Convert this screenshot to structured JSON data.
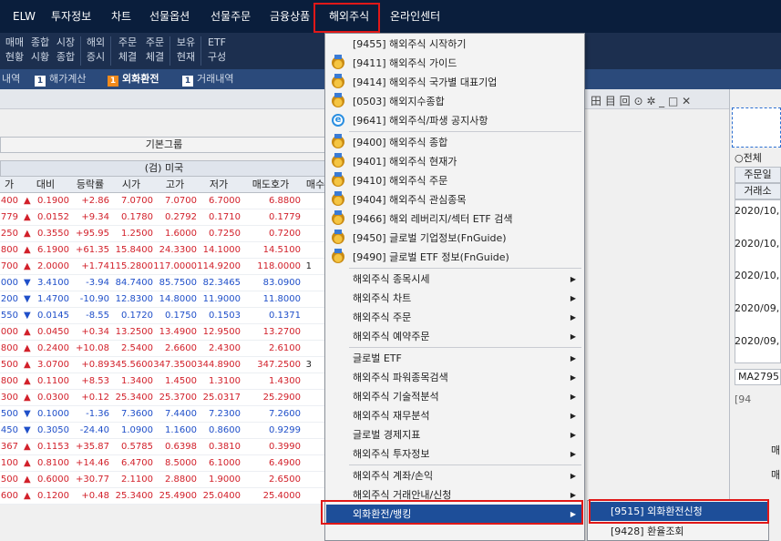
{
  "menubar": {
    "items": [
      "ELW",
      "투자정보",
      "차트",
      "선물옵션",
      "선물주문",
      "금융상품",
      "해외주식",
      "온라인센터"
    ],
    "active_item": "해외주식"
  },
  "toolbar": {
    "buttons": [
      "매매\n현황",
      "종합\n시황",
      "시장\n종합",
      "해외\n증시",
      "주문\n체결",
      "주문\n체결",
      "보유\n현재",
      "ETF\n구성"
    ]
  },
  "tabs": [
    {
      "label": "내역",
      "num": ""
    },
    {
      "label": "해가계산",
      "num": "1"
    },
    {
      "label": "외화환전",
      "num": "1",
      "active": true
    },
    {
      "label": "거래내역",
      "num": "1"
    }
  ],
  "window_controls": "田 目 回 ⊙ ✲ _ □ ✕",
  "group": {
    "label": "기본그룹",
    "market": "(검) 미국"
  },
  "table": {
    "headers": [
      "가",
      "대비",
      "등락률",
      "시가",
      "고가",
      "저가",
      "매도호가",
      "매수"
    ],
    "rows": [
      {
        "p": "400",
        "dir": "up",
        "chg": "0.1900",
        "rate": "+2.86",
        "open": "7.0700",
        "high": "7.0700",
        "low": "6.7000",
        "ask": "6.8800",
        "bid": ""
      },
      {
        "p": "779",
        "dir": "up",
        "chg": "0.0152",
        "rate": "+9.34",
        "open": "0.1780",
        "high": "0.2792",
        "low": "0.1710",
        "ask": "0.1779",
        "bid": ""
      },
      {
        "p": "250",
        "dir": "up",
        "chg": "0.3550",
        "rate": "+95.95",
        "open": "1.2500",
        "high": "1.6000",
        "low": "0.7250",
        "ask": "0.7200",
        "bid": ""
      },
      {
        "p": "800",
        "dir": "up",
        "chg": "6.1900",
        "rate": "+61.35",
        "open": "15.8400",
        "high": "24.3300",
        "low": "14.1000",
        "ask": "14.5100",
        "bid": ""
      },
      {
        "p": "700",
        "dir": "up",
        "chg": "2.0000",
        "rate": "+1.74",
        "open": "115.2800",
        "high": "117.0000",
        "low": "114.9200",
        "ask": "118.0000",
        "bid": "1"
      },
      {
        "p": "000",
        "dir": "dn",
        "chg": "3.4100",
        "rate": "-3.94",
        "open": "84.7400",
        "high": "85.7500",
        "low": "82.3465",
        "ask": "83.0900",
        "bid": ""
      },
      {
        "p": "200",
        "dir": "dn",
        "chg": "1.4700",
        "rate": "-10.90",
        "open": "12.8300",
        "high": "14.8000",
        "low": "11.9000",
        "ask": "11.8000",
        "bid": ""
      },
      {
        "p": "550",
        "dir": "dn",
        "chg": "0.0145",
        "rate": "-8.55",
        "open": "0.1720",
        "high": "0.1750",
        "low": "0.1503",
        "ask": "0.1371",
        "bid": ""
      },
      {
        "p": "000",
        "dir": "up",
        "chg": "0.0450",
        "rate": "+0.34",
        "open": "13.2500",
        "high": "13.4900",
        "low": "12.9500",
        "ask": "13.2700",
        "bid": ""
      },
      {
        "p": "800",
        "dir": "up",
        "chg": "0.2400",
        "rate": "+10.08",
        "open": "2.5400",
        "high": "2.6600",
        "low": "2.4300",
        "ask": "2.6100",
        "bid": ""
      },
      {
        "p": "500",
        "dir": "up",
        "chg": "3.0700",
        "rate": "+0.89",
        "open": "345.5600",
        "high": "347.3500",
        "low": "344.8900",
        "ask": "347.2500",
        "bid": "3"
      },
      {
        "p": "800",
        "dir": "up",
        "chg": "0.1100",
        "rate": "+8.53",
        "open": "1.3400",
        "high": "1.4500",
        "low": "1.3100",
        "ask": "1.4300",
        "bid": ""
      },
      {
        "p": "300",
        "dir": "up",
        "chg": "0.0300",
        "rate": "+0.12",
        "open": "25.3400",
        "high": "25.3700",
        "low": "25.0317",
        "ask": "25.2900",
        "bid": ""
      },
      {
        "p": "500",
        "dir": "dn",
        "chg": "0.1000",
        "rate": "-1.36",
        "open": "7.3600",
        "high": "7.4400",
        "low": "7.2300",
        "ask": "7.2600",
        "bid": ""
      },
      {
        "p": "450",
        "dir": "dn",
        "chg": "0.3050",
        "rate": "-24.40",
        "open": "1.0900",
        "high": "1.1600",
        "low": "0.8600",
        "ask": "0.9299",
        "bid": ""
      },
      {
        "p": "367",
        "dir": "up",
        "chg": "0.1153",
        "rate": "+35.87",
        "open": "0.5785",
        "high": "0.6398",
        "low": "0.3810",
        "ask": "0.3990",
        "bid": ""
      },
      {
        "p": "100",
        "dir": "up",
        "chg": "0.8100",
        "rate": "+14.46",
        "open": "6.4700",
        "high": "8.5000",
        "low": "6.1000",
        "ask": "6.4900",
        "bid": ""
      },
      {
        "p": "500",
        "dir": "up",
        "chg": "0.6000",
        "rate": "+30.77",
        "open": "2.1100",
        "high": "2.8800",
        "low": "1.9000",
        "ask": "2.6500",
        "bid": ""
      },
      {
        "p": "600",
        "dir": "up",
        "chg": "0.1200",
        "rate": "+0.48",
        "open": "25.3400",
        "high": "25.4900",
        "low": "25.0400",
        "ask": "25.4000",
        "bid": ""
      }
    ]
  },
  "dropdown": {
    "items": [
      {
        "label": "[9455] 해외주식 시작하기",
        "icon": ""
      },
      {
        "label": "[9411] 해외주식 가이드",
        "icon": "medal"
      },
      {
        "label": "[9414] 해외주식 국가별 대표기업",
        "icon": "medal"
      },
      {
        "label": "[0503] 해외지수종합",
        "icon": "medal"
      },
      {
        "label": "[9641] 해외주식/파생 공지사항",
        "icon": "ie",
        "sep_after": true
      },
      {
        "label": "[9400] 해외주식 종합",
        "icon": "medal"
      },
      {
        "label": "[9401] 해외주식 현재가",
        "icon": "medal"
      },
      {
        "label": "[9410] 해외주식 주문",
        "icon": "medal"
      },
      {
        "label": "[9404] 해외주식 관심종목",
        "icon": "medal"
      },
      {
        "label": "[9466] 해외 레버리지/섹터 ETF 검색",
        "icon": "medal"
      },
      {
        "label": "[9450] 글로벌 기업정보(FnGuide)",
        "icon": "medal"
      },
      {
        "label": "[9490] 글로벌 ETF 정보(FnGuide)",
        "icon": "medal",
        "sep_after": true
      },
      {
        "label": "해외주식 종목시세",
        "sub": true
      },
      {
        "label": "해외주식 차트",
        "sub": true
      },
      {
        "label": "해외주식 주문",
        "sub": true
      },
      {
        "label": "해외주식 예약주문",
        "sub": true,
        "sep_after": true
      },
      {
        "label": "글로벌 ETF",
        "sub": true
      },
      {
        "label": "해외주식 파워종목검색",
        "sub": true
      },
      {
        "label": "해외주식 기술적분석",
        "sub": true
      },
      {
        "label": "해외주식 재무분석",
        "sub": true
      },
      {
        "label": "글로벌 경제지표",
        "sub": true
      },
      {
        "label": "해외주식 투자정보",
        "sub": true,
        "sep_after": true
      },
      {
        "label": "해외주식 계좌/손익",
        "sub": true
      },
      {
        "label": "해외주식 거래안내/신청",
        "sub": true
      },
      {
        "label": "외화환전/뱅킹",
        "sub": true,
        "selected": true
      }
    ]
  },
  "submenu": {
    "items": [
      {
        "label": "[9515] 외화환전신청",
        "selected": true
      },
      {
        "label": "[9428] 환율조회"
      }
    ]
  },
  "right_panel": {
    "radio_label": "전체",
    "header1": "주문일",
    "header2": "거래소",
    "dates": [
      "2020/10,",
      "2020/10,",
      "2020/10,",
      "2020/09,",
      "2020/09,"
    ],
    "code": "MA2795",
    "bottom_code": "[94",
    "labels": [
      "매",
      "매"
    ]
  },
  "colors": {
    "up": "#d2202a",
    "down": "#1f4fc9",
    "menu_bg": "#0a1e3c",
    "highlight": "#e01818",
    "selected": "#1d4e99"
  }
}
